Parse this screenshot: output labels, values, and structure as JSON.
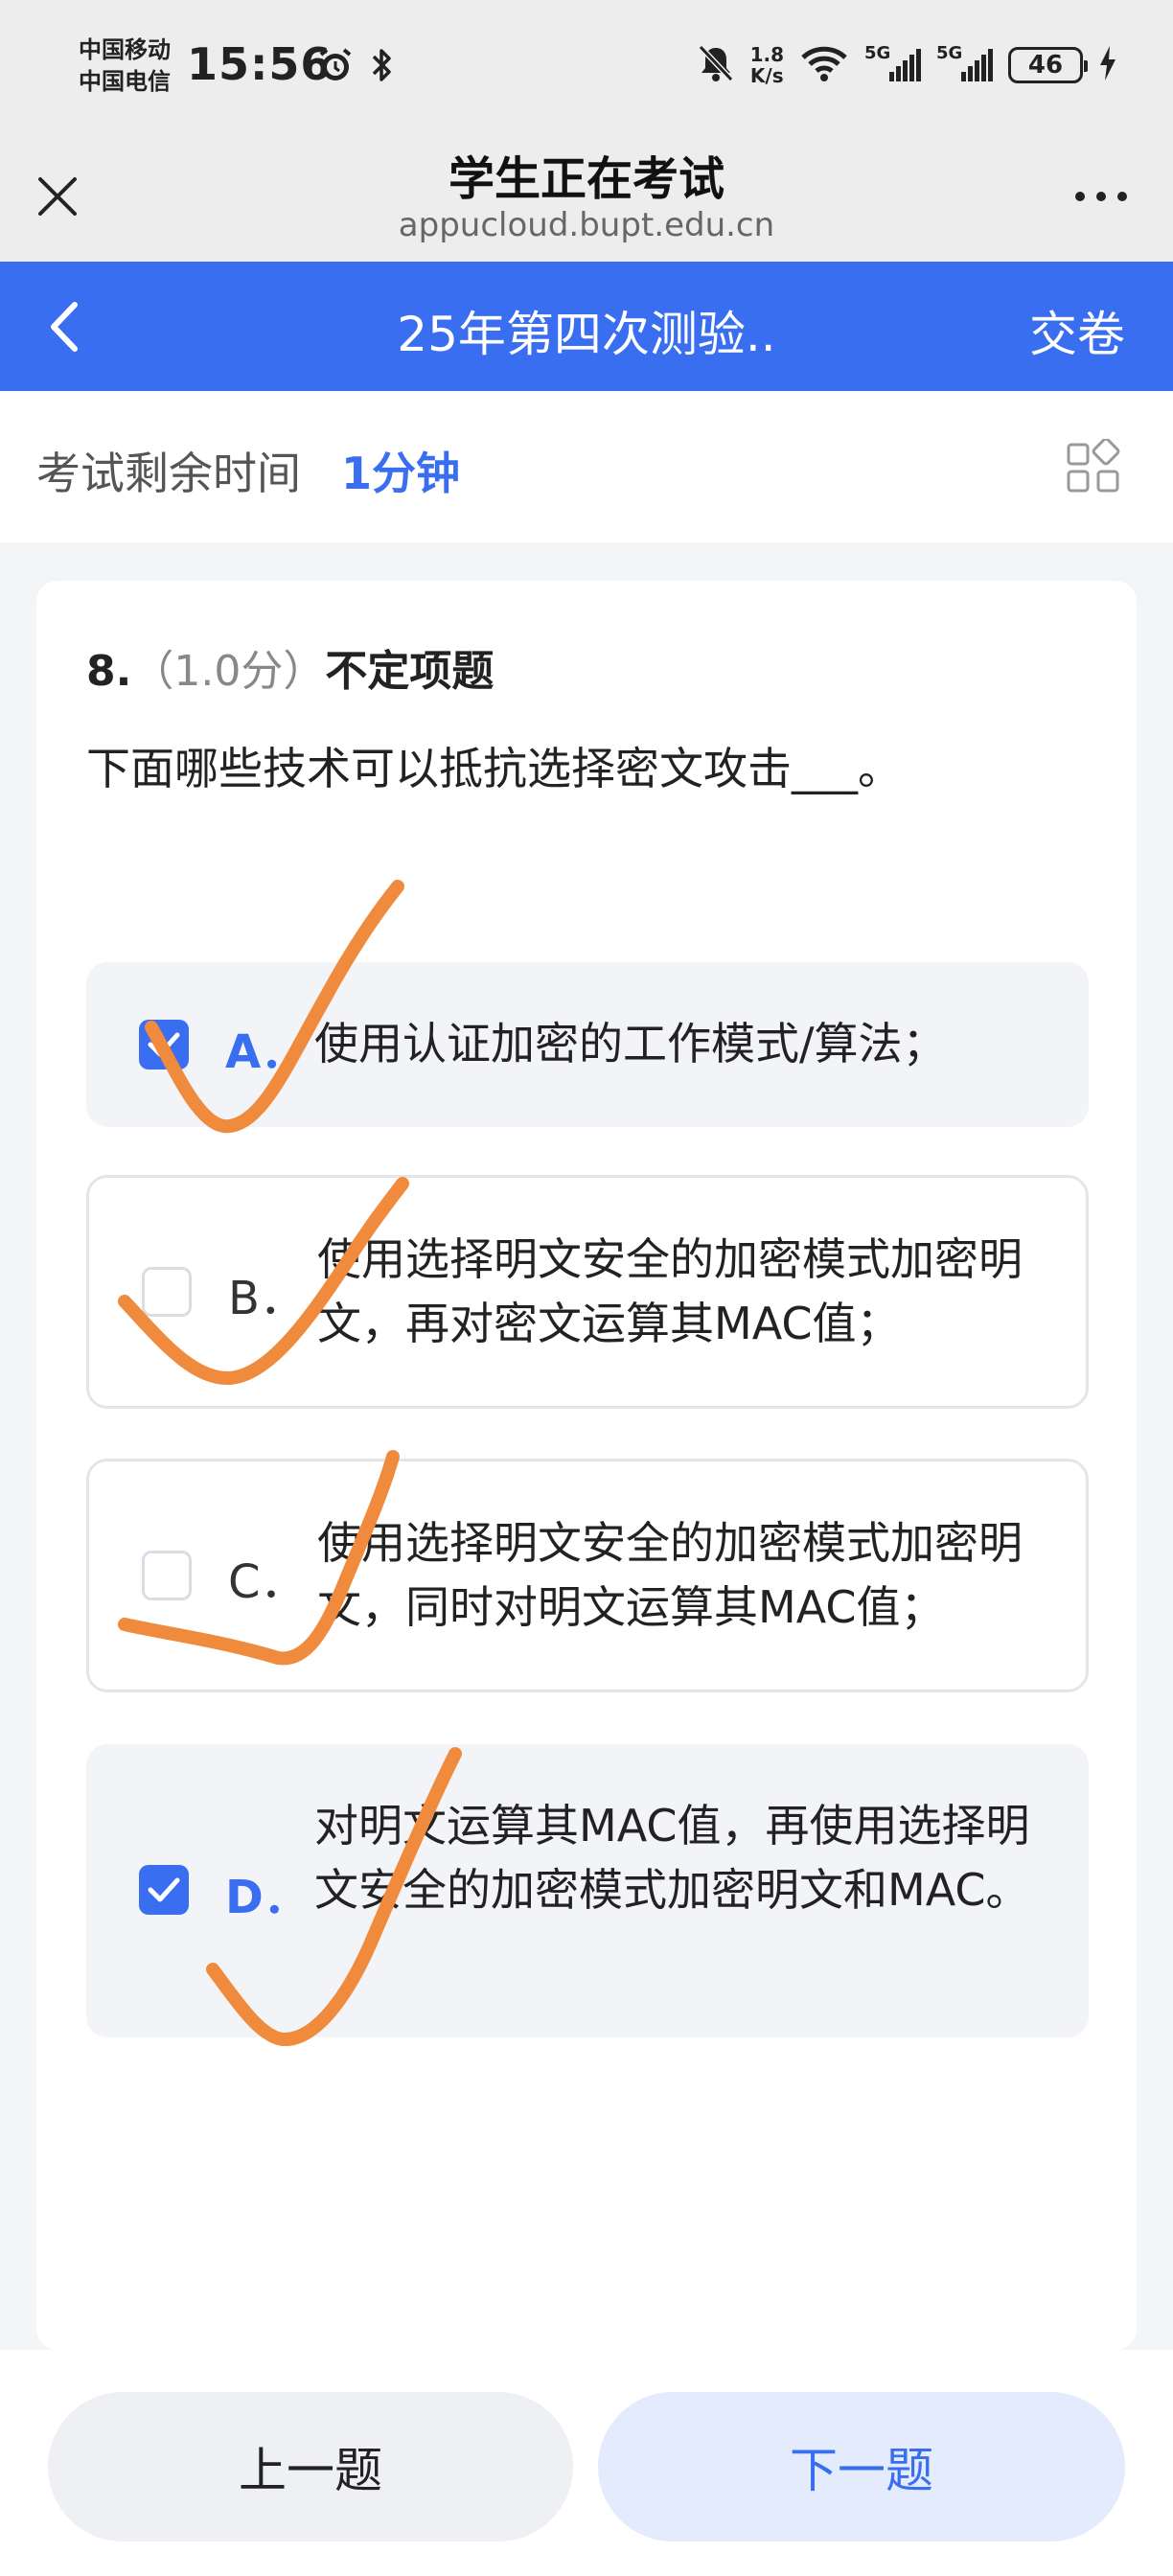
{
  "status_bar": {
    "carrier_1": "中国移动",
    "carrier_2": "中国电信",
    "time": "15:56",
    "net_speed_value": "1.8",
    "net_speed_unit": "K/s",
    "signal_1_label": "5G",
    "signal_2_label": "5G",
    "battery": "46",
    "icons": [
      "alarm-icon",
      "bluetooth-icon",
      "mute-icon",
      "wifi-icon",
      "charging-icon"
    ]
  },
  "browser": {
    "title": "学生正在考试",
    "url": "appucloud.bupt.edu.cn"
  },
  "header": {
    "title": "25年第四次测验..",
    "submit_label": "交卷",
    "accent_color": "#3a6ef0"
  },
  "timer": {
    "label": "考试剩余时间",
    "value": "1分钟"
  },
  "question": {
    "number": "8.",
    "score": "（1.0分）",
    "type": "不定项题",
    "text": "下面哪些技术可以抵抗选择密文攻击___。",
    "options": [
      {
        "letter": "A．",
        "text": "使用认证加密的工作模式/算法；",
        "selected": true
      },
      {
        "letter": "B．",
        "text": "使用选择明文安全的加密模式加密明文，再对密文运算其MAC值；",
        "selected": false
      },
      {
        "letter": "C．",
        "text": "使用选择明文安全的加密模式加密明文，同时对明文运算其MAC值；",
        "selected": false
      },
      {
        "letter": "D．",
        "text": "对明文运算其MAC值，再使用选择明文安全的加密模式加密明文和MAC。",
        "selected": true
      }
    ]
  },
  "nav": {
    "prev_label": "上一题",
    "next_label": "下一题"
  },
  "annotation_color": "#f08a3c"
}
